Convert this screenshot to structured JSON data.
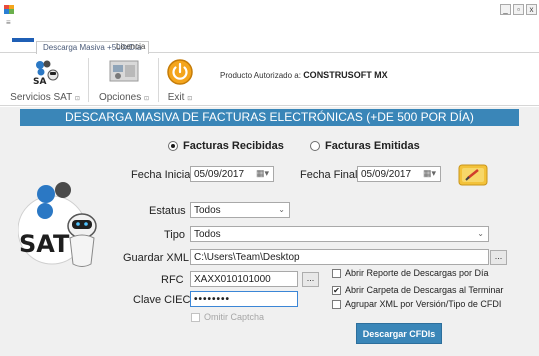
{
  "window": {
    "qa_mark": "≡",
    "controls": [
      "_",
      "▫",
      "x"
    ]
  },
  "tabs": [
    {
      "label": "Descarga Masiva +500xDía",
      "active": true
    },
    {
      "label": "Licencia",
      "active": false
    }
  ],
  "ribbon": {
    "groups": [
      {
        "label": "Servicios SAT",
        "icon": "sat-service-icon"
      },
      {
        "label": "Opciones",
        "icon": "options-icon"
      },
      {
        "label": "Exit",
        "icon": "power-icon"
      }
    ],
    "corner_glyph": "⊡",
    "product_prefix": "Producto Autorizado a:",
    "product_name": "CONSTRUSOFT MX"
  },
  "banner": "DESCARGA MASIVA DE FACTURAS ELECTRÓNICAS (+DE 500 POR DÍA)",
  "radios": {
    "received": "Facturas Recibidas",
    "issued": "Facturas Emitidas",
    "selected": "received"
  },
  "form": {
    "fecha_inicial_label": "Fecha Inicial",
    "fecha_inicial": "05/09/2017",
    "fecha_final_label": "Fecha Final",
    "fecha_final": "05/09/2017",
    "estatus_label": "Estatus",
    "estatus": "Todos",
    "tipo_label": "Tipo",
    "tipo": "Todos",
    "guardar_label": "Guardar XML",
    "guardar": "C:\\Users\\Team\\Desktop",
    "rfc_label": "RFC",
    "rfc": "XAXX010101000",
    "ciec_label": "Clave CIEC",
    "ciec": "••••••••",
    "browse": "...",
    "omitir_captcha": "Omitir Captcha"
  },
  "options": [
    {
      "label": "Abrir Reporte de Descargas por Día",
      "checked": false
    },
    {
      "label": "Abrir Carpeta de Descargas al Terminar",
      "checked": true
    },
    {
      "label": "Agrupar XML por Versión/Tipo de CFDI",
      "checked": false
    }
  ],
  "download_button": "Descargar CFDIs",
  "logo_text": "SAT",
  "colors": {
    "banner": "#3a86b8",
    "primary_button": "#3a86b8",
    "exit_icon": "#f4a51c"
  }
}
